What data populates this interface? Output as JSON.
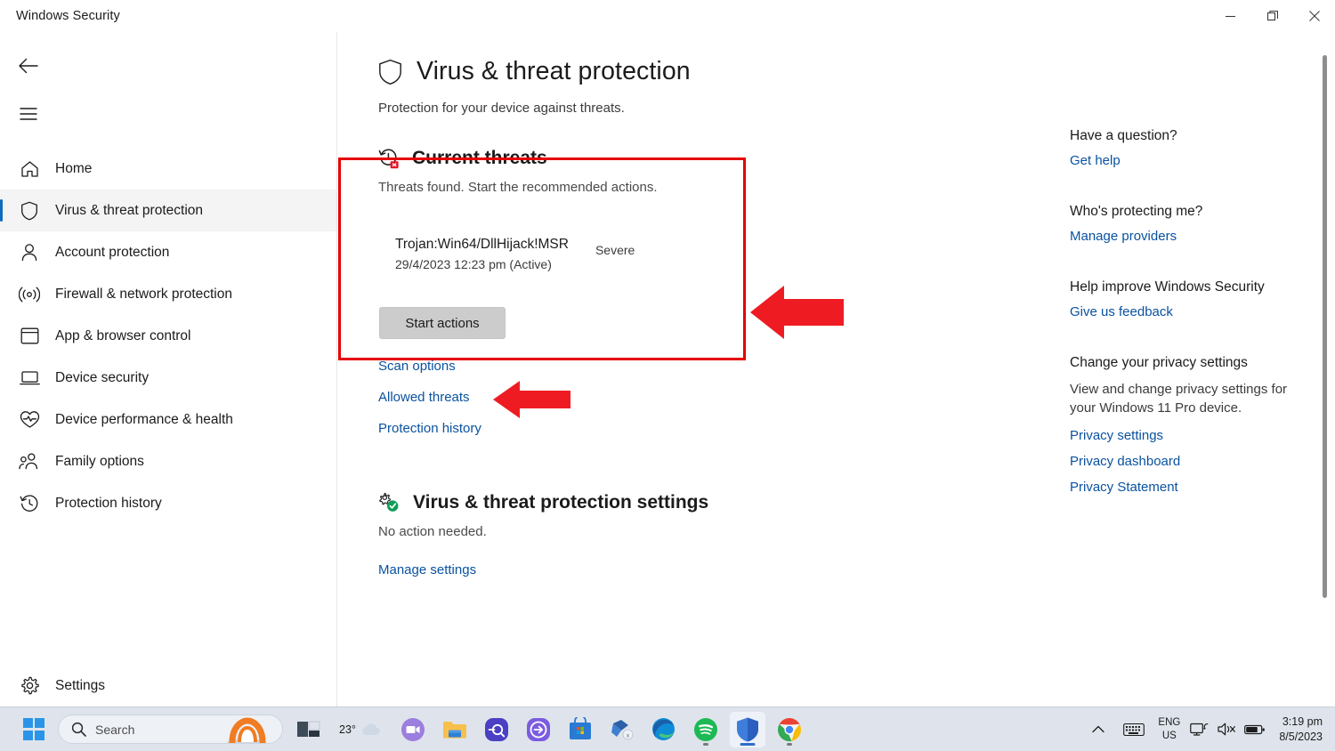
{
  "window": {
    "title": "Windows Security",
    "minimize_label": "Minimize",
    "restore_label": "Restore",
    "close_label": "Close"
  },
  "nav": {
    "back_label": "Back",
    "menu_label": "Open navigation",
    "items": [
      {
        "label": "Home",
        "icon": "home-icon",
        "selected": false
      },
      {
        "label": "Virus & threat protection",
        "icon": "shield-icon",
        "selected": true
      },
      {
        "label": "Account protection",
        "icon": "person-icon",
        "selected": false
      },
      {
        "label": "Firewall & network protection",
        "icon": "wireless-icon",
        "selected": false
      },
      {
        "label": "App & browser control",
        "icon": "window-icon",
        "selected": false
      },
      {
        "label": "Device security",
        "icon": "laptop-icon",
        "selected": false
      },
      {
        "label": "Device performance & health",
        "icon": "heart-pulse-icon",
        "selected": false
      },
      {
        "label": "Family options",
        "icon": "people-icon",
        "selected": false
      },
      {
        "label": "Protection history",
        "icon": "history-icon",
        "selected": false
      }
    ],
    "settings": {
      "label": "Settings",
      "icon": "gear-icon"
    }
  },
  "page": {
    "title": "Virus & threat protection",
    "title_icon": "shield-icon",
    "subtitle": "Protection for your device against threats."
  },
  "current_threats": {
    "icon": "threat-history-icon",
    "title": "Current threats",
    "subtitle": "Threats found. Start the recommended actions.",
    "threat": {
      "name": "Trojan:Win64/DllHijack!MSR",
      "date": "29/4/2023 12:23 pm (Active)",
      "severity": "Severe"
    },
    "start_actions_label": "Start actions",
    "links": [
      "Scan options",
      "Allowed threats",
      "Protection history"
    ]
  },
  "settings_section": {
    "icon": "settings-shield-icon",
    "title": "Virus & threat protection settings",
    "subtitle": "No action needed.",
    "link": "Manage settings"
  },
  "info_pane": {
    "groups": [
      {
        "heading": "Have a question?",
        "links": [
          "Get help"
        ]
      },
      {
        "heading": "Who's protecting me?",
        "links": [
          "Manage providers"
        ]
      },
      {
        "heading": "Help improve Windows Security",
        "links": [
          "Give us feedback"
        ]
      },
      {
        "heading": "Change your privacy settings",
        "paragraph": "View and change privacy settings for your Windows 11 Pro device.",
        "links": [
          "Privacy settings",
          "Privacy dashboard",
          "Privacy Statement"
        ]
      }
    ]
  },
  "taskbar": {
    "start_label": "Start",
    "search_placeholder": "Search",
    "search_value": "",
    "weather_temp": "23°",
    "apps": [
      {
        "name": "taskview-icon"
      },
      {
        "name": "chat-icon"
      },
      {
        "name": "file-explorer-icon"
      },
      {
        "name": "search-app-icon"
      },
      {
        "name": "arrow-app-icon"
      },
      {
        "name": "microsoft-store-icon"
      },
      {
        "name": "onedrive-icon"
      },
      {
        "name": "microsoft-edge-icon"
      },
      {
        "name": "spotify-icon"
      },
      {
        "name": "windows-security-icon"
      },
      {
        "name": "google-chrome-icon"
      }
    ],
    "language": {
      "line1": "ENG",
      "line2": "US"
    },
    "clock": {
      "time": "3:19 pm",
      "date": "8/5/2023"
    }
  },
  "annotations": {
    "highlight_color": "#e60000",
    "arrow_color": "#ee1c22",
    "arrow_threat_label": "arrow pointing at current threats box",
    "arrow_button_label": "arrow pointing at Start actions button"
  }
}
